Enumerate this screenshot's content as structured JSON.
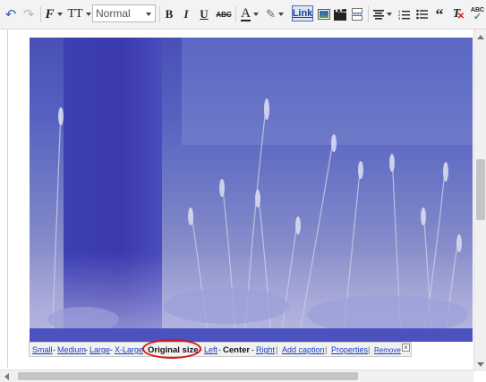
{
  "toolbar": {
    "undo_icon": "undo-icon",
    "redo_icon": "redo-icon",
    "font_icon": "F",
    "font_size_icon": "TT",
    "format_value": "Normal",
    "bold": "B",
    "italic": "I",
    "underline": "U",
    "strikethrough": "ABC",
    "text_color": "A",
    "link_label": "Link",
    "spellcheck": "ABC"
  },
  "caption_bar": {
    "small": "Small",
    "medium": "Medium",
    "large": "Large",
    "xlarge": "X-Large",
    "original": "Original size",
    "left": "Left",
    "center": "Center",
    "right": "Right",
    "add_caption": "Add caption",
    "properties": "Properties",
    "remove": "Remove",
    "dash": "-",
    "pipe": "|"
  },
  "colors": {
    "annotation_oval": "#dd1111",
    "link_color": "#1a3dbf"
  }
}
